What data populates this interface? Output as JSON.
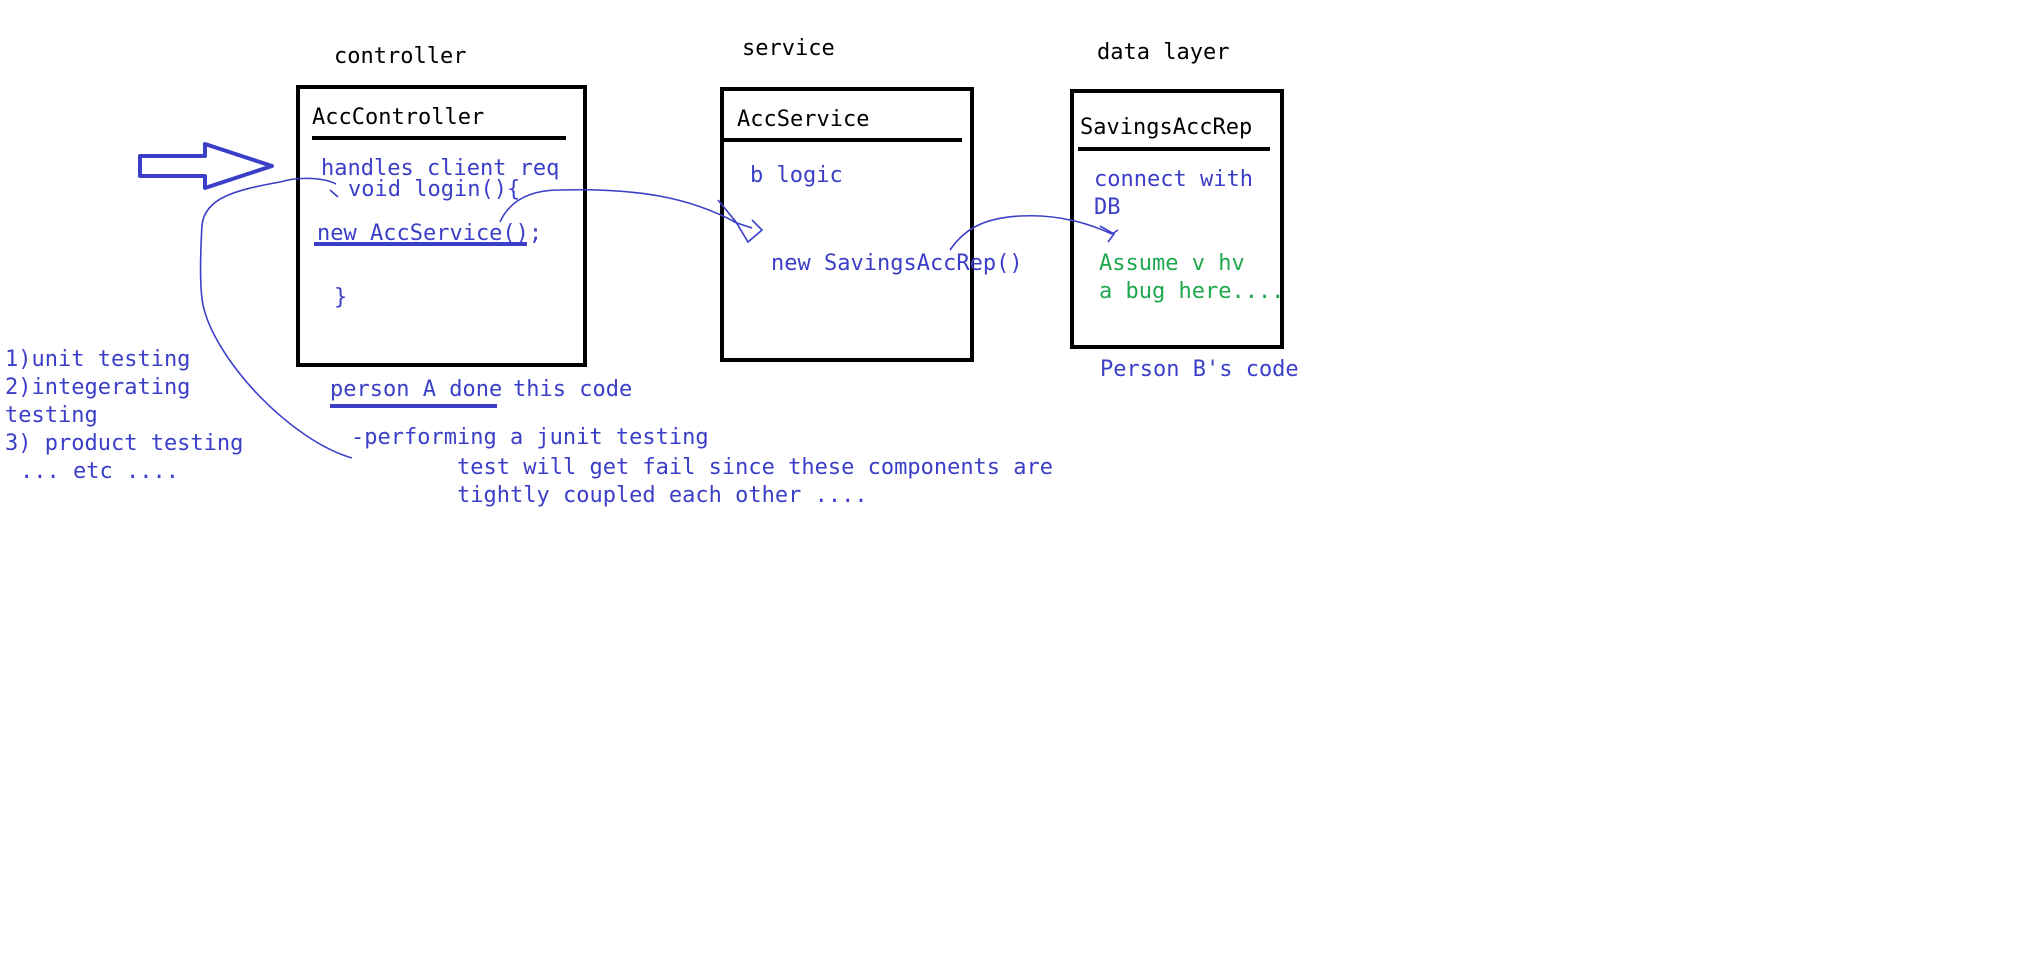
{
  "layers": {
    "controller": "controller",
    "service": "service",
    "data_layer": "data layer"
  },
  "controller_box": {
    "title": "AccController",
    "line1": "handles client req",
    "line2": "void login(){",
    "line3": "new AccService();",
    "line4": "}"
  },
  "service_box": {
    "title": "AccService",
    "line1": "b logic",
    "line2": "new SavingsAccRep()"
  },
  "data_box": {
    "title": "SavingsAccRep",
    "line1": "connect with",
    "line2": "DB",
    "bug1": "Assume v hv",
    "bug2": "a bug here...."
  },
  "notes": {
    "person_a_underlined": "person A done",
    "person_a_rest": "this code",
    "person_b": "Person B's code",
    "junit": "-performing a junit testing",
    "fail1": "test will get fail since these components are",
    "fail2": "tightly coupled each other ....",
    "testing1": "1)unit testing",
    "testing2": "2)integerating",
    "testing3": "testing",
    "testing4": "3) product testing",
    "testing5": "... etc ...."
  },
  "colors": {
    "ink_blue": "#3b3fc7",
    "ink_green": "#1fa84f",
    "ink_black": "#000000"
  }
}
